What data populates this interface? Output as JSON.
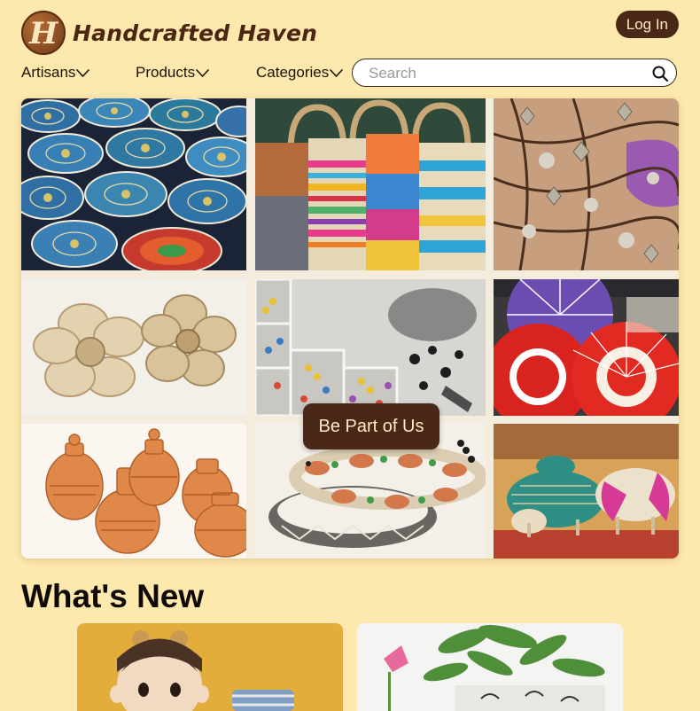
{
  "header": {
    "logo_letter": "H",
    "site_name": "Handcrafted Haven",
    "login_label": "Log In"
  },
  "nav": {
    "items": [
      {
        "label": "Artisans"
      },
      {
        "label": "Products"
      },
      {
        "label": "Categories"
      }
    ],
    "search_placeholder": "Search",
    "search_value": ""
  },
  "hero": {
    "cta_label": "Be Part of Us",
    "tiles": [
      {
        "subject": "painted-ceramic-plates"
      },
      {
        "subject": "woven-colorful-bags"
      },
      {
        "subject": "flower-charm-jewelry"
      },
      {
        "subject": "crochet-jute-flowers"
      },
      {
        "subject": "beads-and-crafting-tools"
      },
      {
        "subject": "paper-parasols"
      },
      {
        "subject": "terracotta-pottery"
      },
      {
        "subject": "braided-bracelets"
      },
      {
        "subject": "woven-animal-figures"
      }
    ]
  },
  "whats_new": {
    "title": "What's New",
    "cards": [
      {
        "subject": "plush-doll"
      },
      {
        "subject": "potted-plants"
      }
    ]
  },
  "colors": {
    "background": "#fde8ad",
    "accent_dark_brown": "#4a2818",
    "logo_brown": "#8a4d22",
    "button_text": "#fce9c5"
  },
  "icons": {
    "search": "search-icon",
    "dropdown": "chevron-down-icon"
  }
}
